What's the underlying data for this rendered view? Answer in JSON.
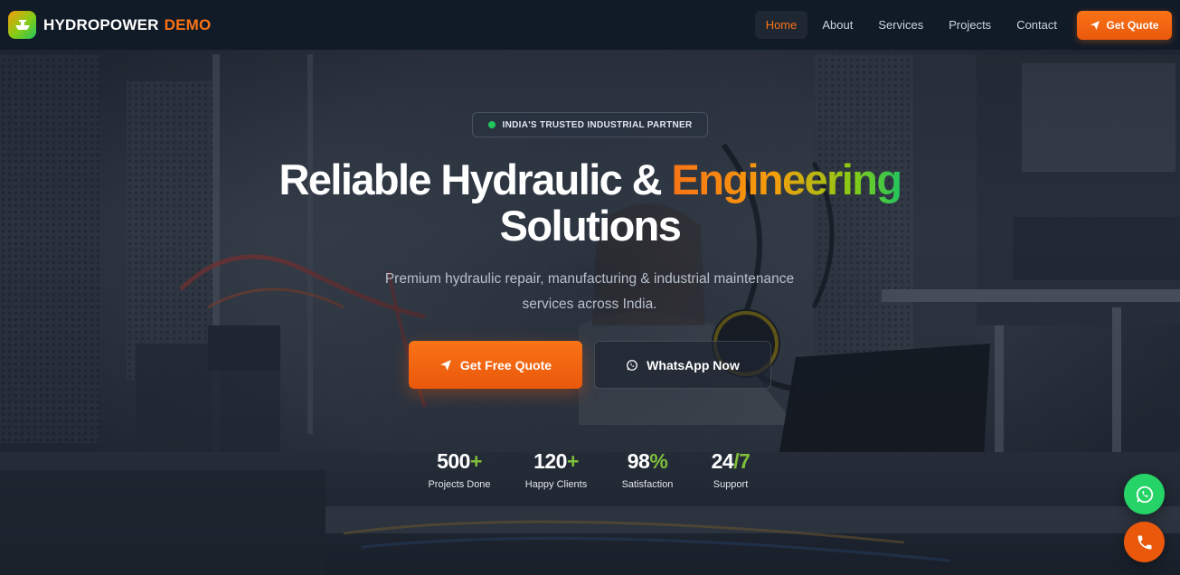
{
  "navbar": {
    "brand_main": "HYDROPOWER",
    "brand_accent": "DEMO",
    "links": [
      {
        "label": "Home",
        "active": true
      },
      {
        "label": "About",
        "active": false
      },
      {
        "label": "Services",
        "active": false
      },
      {
        "label": "Projects",
        "active": false
      },
      {
        "label": "Contact",
        "active": false
      }
    ],
    "cta_label": "Get Quote"
  },
  "hero": {
    "badge": "INDIA'S TRUSTED INDUSTRIAL PARTNER",
    "title_part1": "Reliable Hydraulic &",
    "title_highlight": "Engineering",
    "title_part2": "Solutions",
    "subtitle": "Premium hydraulic repair, manufacturing & industrial maintenance services across India.",
    "primary_button": "Get Free Quote",
    "secondary_button": "WhatsApp Now"
  },
  "stats": [
    {
      "value": "500",
      "suffix": "+",
      "label": "Projects Done"
    },
    {
      "value": "120",
      "suffix": "+",
      "label": "Happy Clients"
    },
    {
      "value": "98",
      "suffix": "%",
      "label": "Satisfaction"
    },
    {
      "value": "24",
      "suffix": "/7",
      "label": "Support"
    }
  ],
  "floating": {
    "whatsapp_icon": "whatsapp-icon",
    "phone_icon": "phone-icon"
  },
  "colors": {
    "accent": "#f97316",
    "green": "#22c55e",
    "navbar_bg": "#111a27"
  }
}
